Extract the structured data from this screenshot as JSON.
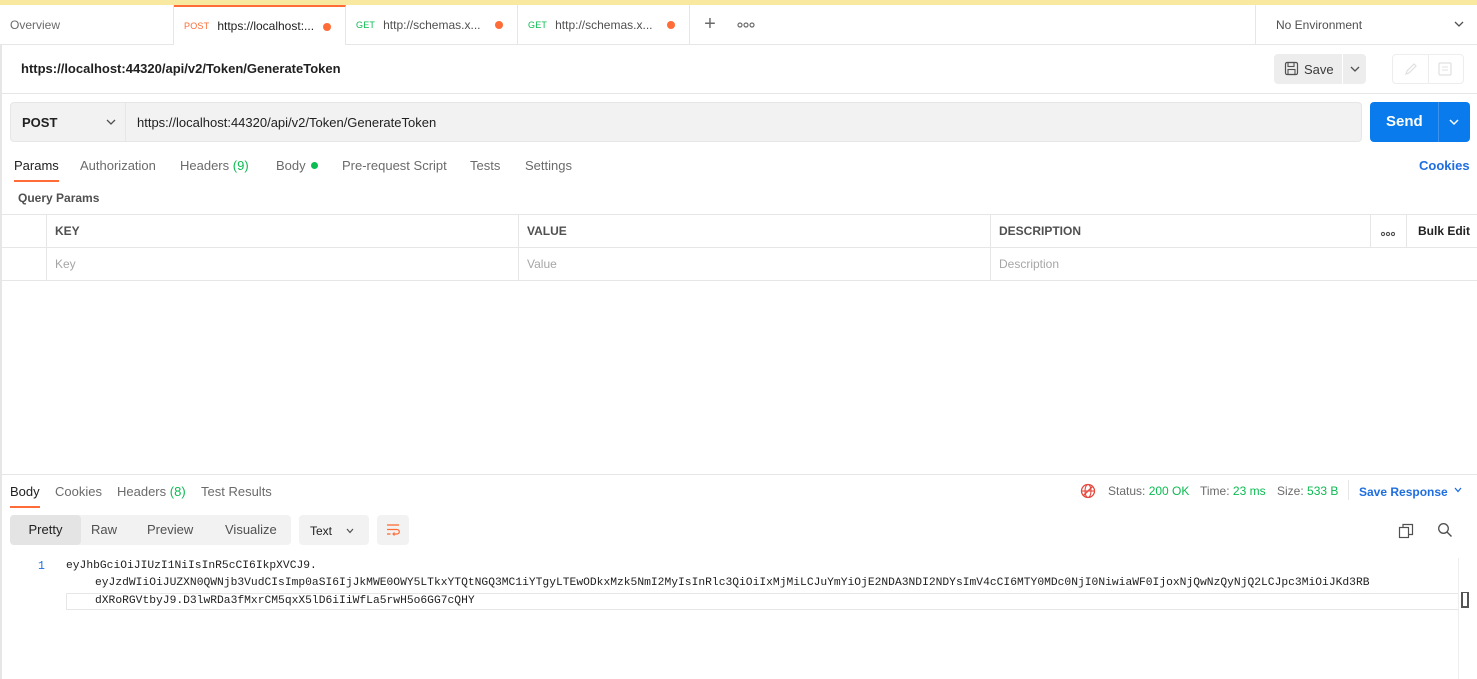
{
  "tabs": [
    {
      "label": "Overview"
    },
    {
      "method": "POST",
      "label": "https://localhost:...",
      "method_color": "#ff6c37"
    },
    {
      "method": "GET",
      "label": "http://schemas.x...",
      "method_color": "#0cbb52"
    },
    {
      "method": "GET",
      "label": "http://schemas.x...",
      "method_color": "#0cbb52"
    }
  ],
  "environment": {
    "label": "No Environment"
  },
  "request": {
    "title": "https://localhost:44320/api/v2/Token/GenerateToken",
    "method": "POST",
    "url": "https://localhost:44320/api/v2/Token/GenerateToken",
    "save_label": "Save",
    "send_label": "Send"
  },
  "request_tabs": {
    "params": "Params",
    "authorization": "Authorization",
    "headers": "Headers",
    "headers_count": "(9)",
    "body": "Body",
    "prerequest": "Pre-request Script",
    "tests": "Tests",
    "settings": "Settings",
    "cookies": "Cookies"
  },
  "query_params": {
    "label": "Query Params",
    "columns": [
      "KEY",
      "VALUE",
      "DESCRIPTION"
    ],
    "bulk_edit": "Bulk Edit",
    "placeholders": [
      "Key",
      "Value",
      "Description"
    ]
  },
  "response": {
    "tabs": {
      "body": "Body",
      "cookies": "Cookies",
      "headers": "Headers",
      "headers_count": "(8)",
      "test_results": "Test Results"
    },
    "status_label": "Status:",
    "status_value": "200 OK",
    "time_label": "Time:",
    "time_value": "23 ms",
    "size_label": "Size:",
    "size_value": "533 B",
    "save_response": "Save Response",
    "views": [
      "Pretty",
      "Raw",
      "Preview",
      "Visualize"
    ],
    "format": "Text",
    "line_number": "1",
    "body_lines": [
      "eyJhbGciOiJIUzI1NiIsInR5cCI6IkpXVCJ9.",
      "eyJzdWIiOiJUZXN0QWNjb3VudCIsImp0aSI6IjJkMWE0OWY5LTkxYTQtNGQ3MC1iYTgyLTEwODkxMzk5NmI2MyIsInRlc3QiOiIxMjMiLCJuYmYiOjE2NDA3NDI2NDYsImV4cCI6MTY0MDc0NjI0NiwiaWF0IjoxNjQwNzQyNjQ2LCJpc3MiOiJKd3RB",
      "dXRoRGVtbyJ9.D3lwRDa3fMxrCM5qxX5lD6iIiWfLa5rwH5o6GG7cQHY"
    ]
  },
  "colors": {
    "accent": "#ff6c37",
    "send": "#097bed",
    "success": "#0cbb52",
    "link": "#1f6ee0"
  }
}
